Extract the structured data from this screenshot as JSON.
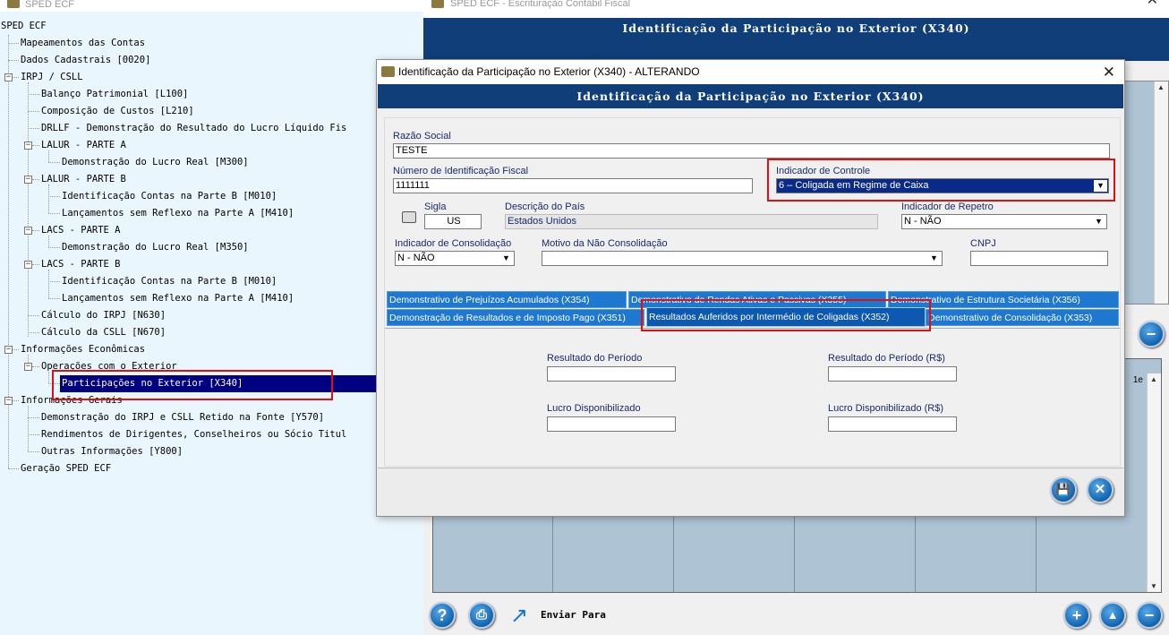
{
  "tree_window": {
    "title": "SPED ECF",
    "nodes": [
      {
        "label": "SPED ECF"
      },
      {
        "label": "Mapeamentos das Contas"
      },
      {
        "label": "Dados Cadastrais [0020]"
      },
      {
        "label": "IRPJ / CSLL"
      },
      {
        "label": "Balanço Patrimonial [L100]"
      },
      {
        "label": "Composição de Custos [L210]"
      },
      {
        "label": "DRLLF - Demonstração do Resultado do Lucro Líquido Fis"
      },
      {
        "label": "LALUR - PARTE A"
      },
      {
        "label": "Demonstração do Lucro Real [M300]"
      },
      {
        "label": "LALUR - PARTE B"
      },
      {
        "label": "Identificação Contas na Parte B [M010]"
      },
      {
        "label": "Lançamentos sem Reflexo na Parte A [M410]"
      },
      {
        "label": "LACS - PARTE A"
      },
      {
        "label": "Demonstração do Lucro Real [M350]"
      },
      {
        "label": "LACS - PARTE B"
      },
      {
        "label": "Identificação Contas na Parte B [M010]"
      },
      {
        "label": "Lançamentos sem Reflexo na Parte A [M410]"
      },
      {
        "label": "Cálculo do IRPJ [N630]"
      },
      {
        "label": "Cálculo da CSLL [N670]"
      },
      {
        "label": "Informações Econômicas"
      },
      {
        "label": "Operações com o Exterior"
      },
      {
        "label": "Participações no Exterior [X340]"
      },
      {
        "label": "Informações Gerais"
      },
      {
        "label": "Demonstração do IRPJ e CSLL Retido na Fonte [Y570]"
      },
      {
        "label": "Rendimentos de Dirigentes, Conselheiros ou Sócio Titul"
      },
      {
        "label": "Outras Informações [Y800]"
      },
      {
        "label": "Geração SPED ECF"
      }
    ],
    "expander_symbol": "−"
  },
  "bg_window": {
    "title": "SPED ECF  -  Escrituração Contábil Fiscal",
    "close_symbol": "✕",
    "banner": "Identificação da Participação no Exterior (X340)",
    "enviar_label": "Enviar Para",
    "buttons": {
      "help": "?",
      "print": "⎙",
      "minus_top": "−",
      "add": "+",
      "up": "▲",
      "minus_bottom": "−"
    },
    "grid2_header_fragment": "1e"
  },
  "dialog": {
    "title": "Identificação da Participação no Exterior (X340)  -  ALTERANDO",
    "close_symbol": "✕",
    "banner": "Identificação da Participação no Exterior (X340)",
    "fields": {
      "razao_social": {
        "label": "Razão Social",
        "value": "TESTE"
      },
      "nif": {
        "label": "Número de Identificação Fiscal",
        "value": "1111111"
      },
      "ind_controle": {
        "label": "Indicador de Controle",
        "value": "6 – Coligada em Regime de Caixa"
      },
      "sigla": {
        "label": "Sigla",
        "value": "US"
      },
      "pais": {
        "label": "Descrição do País",
        "value": "Estados Unidos"
      },
      "ind_repetro": {
        "label": "Indicador de Repetro",
        "value": "N - NÃO"
      },
      "ind_consolidacao": {
        "label": "Indicador de Consolidação",
        "value": "N - NÃO"
      },
      "motivo": {
        "label": "Motivo da Não Consolidação",
        "value": ""
      },
      "cnpj": {
        "label": "CNPJ",
        "value": ""
      }
    },
    "combo_arrow": "▼",
    "tabs": [
      "Demonstrativo de Prejuízos Acumulados (X354)",
      "Demonstrativo de Rendas Ativas e Passivas (X355)",
      "Demonstrativo de Estrutura Societária (X356)",
      "Demonstração de Resultados e de Imposto Pago (X351)",
      "Resultados Auferidos por Intermédio de Coligadas (X352)",
      "Demonstrativo de Consolidação (X353)"
    ],
    "result_fields": {
      "resultado_periodo": {
        "label": "Resultado do Período",
        "value": ""
      },
      "resultado_periodo_rs": {
        "label": "Resultado do Período (R$)",
        "value": ""
      },
      "lucro_disp": {
        "label": "Lucro Disponibilizado",
        "value": ""
      },
      "lucro_disp_rs": {
        "label": "Lucro Disponibilizado (R$)",
        "value": ""
      }
    },
    "footer_buttons": {
      "save": "💾",
      "close": "✕"
    }
  },
  "colors": {
    "banner": "#0f3e78",
    "tab": "#1e78d0",
    "selected": "#000080",
    "highlight_box": "#e01010",
    "tree_bg": "#eaf6fd"
  }
}
